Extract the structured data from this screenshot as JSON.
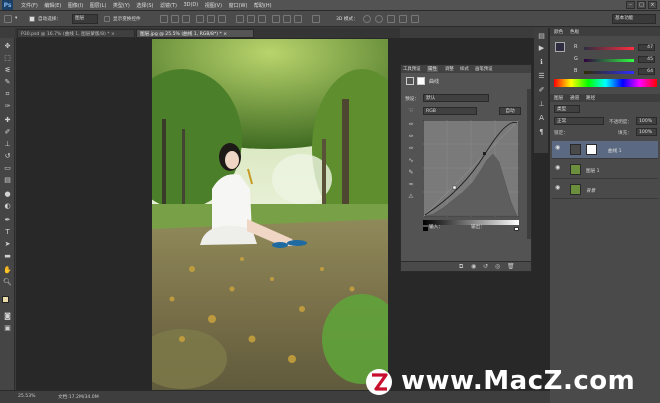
{
  "app": {
    "logo": "Ps"
  },
  "menubar": {
    "items": [
      "文件(F)",
      "编辑(E)",
      "图像(I)",
      "图层(L)",
      "类型(Y)",
      "选择(S)",
      "滤镜(T)",
      "3D(D)",
      "视图(V)",
      "窗口(W)",
      "帮助(H)"
    ],
    "win_controls": [
      "–",
      "□",
      "×"
    ]
  },
  "options": {
    "auto_select_label": "自动选择：",
    "auto_select_value": "图层",
    "show_transform": "显示变换控件",
    "mode_3d": "3D 模式：",
    "workspace": "基本功能"
  },
  "tabs": [
    {
      "label": "P30.psd @ 16.7% (曲线 1, 图层蒙版/8) *",
      "close": "×"
    },
    {
      "label": "图层.jpg @ 25.5% (曲线 1, RGB/8*) *",
      "close": "×"
    }
  ],
  "curves_panel": {
    "tabs": [
      "工具预设",
      "属性",
      "调整",
      "样式",
      "画笔预设"
    ],
    "title": "曲线",
    "preset_label": "预设：",
    "preset_value": "默认",
    "channel_value": "RGB",
    "auto_button": "自动",
    "input_label": "输入：",
    "output_label": "输出："
  },
  "color_panel": {
    "tabs": [
      "颜色",
      "色板"
    ],
    "r_label": "R",
    "r_value": "47",
    "g_label": "G",
    "g_value": "45",
    "b_label": "B",
    "b_value": "64"
  },
  "layers_panel": {
    "tabs": [
      "图层",
      "通道",
      "路径"
    ],
    "filter_kind": "类型",
    "blend_mode": "正常",
    "opacity_label": "不透明度：",
    "opacity_value": "100%",
    "lock_label": "锁定：",
    "fill_label": "填充：",
    "fill_value": "100%",
    "layers": [
      {
        "name": "曲线 1"
      },
      {
        "name": "图层 1"
      },
      {
        "name": "背景"
      }
    ]
  },
  "status": {
    "zoom": "25.53%",
    "doc_size": "文档:17.2M/34.0M"
  },
  "watermark": {
    "text": "www.MacZ.com"
  },
  "colors": {
    "accent": "#c8102e",
    "panel": "#535353",
    "canvas_bg": "#282828"
  }
}
